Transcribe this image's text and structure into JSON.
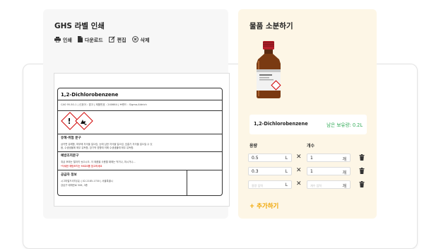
{
  "ghs": {
    "title": "GHS 라벨 인쇄",
    "toolbar": {
      "print_label": "인쇄",
      "download_label": "다운로드",
      "edit_label": "편집",
      "delete_label": "삭제"
    },
    "label": {
      "chemical_name": "1,2-Dichlorobenzene",
      "meta": "CAS 95-50-1 | 신호어 : 경고 | 제품번호 : 240664 | 브랜드 : Sigma-Aldrich",
      "hazard_title": "유해·위험 문구",
      "hazard_text_1": "삼키면 유해함, 피부에 자극을 일으킴, 눈에 심한 자극을 일으킴, 호흡기 자극을 일으킬 수 있",
      "hazard_text_2": "음, 수생생물에 매우 유독함, 장기적 영향에 의해 수생생물에 매우 유독함.",
      "prevention_title": "예방조치문구",
      "prevention_text": "취급 후에는 철저히 씻으시오. 이 제품을 사용할 때에는 먹거나, 마시거나...",
      "prevention_note": "*자세한 예방조치는 MSDS를 참고하세요",
      "supplier_title": "공급자 정보",
      "supplier_text_1": "시그마알드리치(유) | 02-2185-1700 | 서울특별시",
      "supplier_text_2": "강남구 테헤란로 508, 3층"
    }
  },
  "dispense": {
    "title": "물품 소분하기",
    "product_name": "1,2-Dichlorobenzene",
    "remaining": "남은 보유량: 0.2L",
    "col_volume": "용량",
    "col_count": "개수",
    "rows": [
      {
        "volume": "0.5",
        "volume_unit": "L",
        "count": "1",
        "count_unit": "개"
      },
      {
        "volume": "0.3",
        "volume_unit": "L",
        "count": "1",
        "count_unit": "개"
      }
    ],
    "new_row": {
      "volume_placeholder": "용량 입력",
      "volume_unit": "L",
      "count_placeholder": "개수 입력",
      "count_unit": "개"
    },
    "times_symbol": "✕",
    "add_label": "+ 추가하기"
  },
  "colors": {
    "accent": "#f0a500",
    "remaining_green": "#2faa55",
    "hazard_red": "#d00000",
    "right_panel_bg": "#fdf6e6"
  },
  "icons": {
    "print": "printer-icon",
    "download": "file-icon",
    "edit": "edit-icon",
    "delete": "x-circle-icon",
    "trash": "trash-icon"
  }
}
